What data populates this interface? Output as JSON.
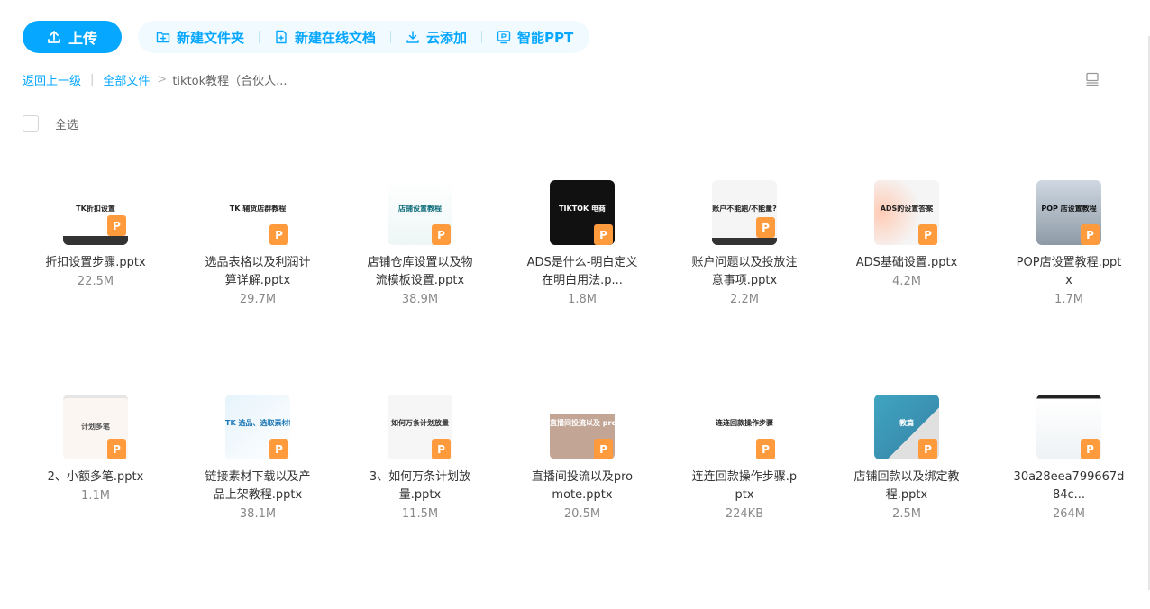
{
  "toolbar": {
    "upload_label": "上传",
    "new_folder_label": "新建文件夹",
    "new_doc_label": "新建在线文档",
    "cloud_add_label": "云添加",
    "smart_ppt_label": "智能PPT"
  },
  "breadcrumb": {
    "back_label": "返回上一级",
    "all_files_label": "全部文件",
    "current_label": "tiktok教程（合伙人..."
  },
  "select_all_label": "全选",
  "colors": {
    "accent": "#06a7ff",
    "ppt_badge": "#ff9a3d"
  },
  "files": [
    {
      "name": "折扣设置步骤.pptx",
      "size": "22.5M",
      "thumb_text": "TK折扣设置"
    },
    {
      "name": "选品表格以及利润计算详解.pptx",
      "size": "29.7M",
      "thumb_text": "TK 辅货店群教程"
    },
    {
      "name": "店铺仓库设置以及物流模板设置.pptx",
      "size": "38.9M",
      "thumb_text": "店铺设置教程"
    },
    {
      "name": "ADS是什么-明白定义在明白用法.p...",
      "size": "1.8M",
      "thumb_text": "TIKTOK 电商"
    },
    {
      "name": "账户问题以及投放注意事项.pptx",
      "size": "2.2M",
      "thumb_text": "账户不能跑/不能量?"
    },
    {
      "name": "ADS基础设置.pptx",
      "size": "4.2M",
      "thumb_text": "ADS的设置答案"
    },
    {
      "name": "POP店设置教程.pptx",
      "size": "1.7M",
      "thumb_text": "POP 店设置教程"
    },
    {
      "name": "2、小额多笔.pptx",
      "size": "1.1M",
      "thumb_text": "计划多笔"
    },
    {
      "name": "链接素材下载以及产品上架教程.pptx",
      "size": "38.1M",
      "thumb_text": "TK 选品、选取素材教程"
    },
    {
      "name": "3、如何万条计划放量.pptx",
      "size": "11.5M",
      "thumb_text": "如何万条计划放量"
    },
    {
      "name": "直播间投流以及promote.pptx",
      "size": "20.5M",
      "thumb_text": "直播间投流以及 promote"
    },
    {
      "name": "连连回款操作步骤.pptx",
      "size": "224KB",
      "thumb_text": "连连回款操作步骤"
    },
    {
      "name": "店铺回款以及绑定教程.pptx",
      "size": "2.5M",
      "thumb_text": "教篇"
    },
    {
      "name": "30a28eea799667d84c...",
      "size": "264M",
      "thumb_text": ""
    }
  ]
}
